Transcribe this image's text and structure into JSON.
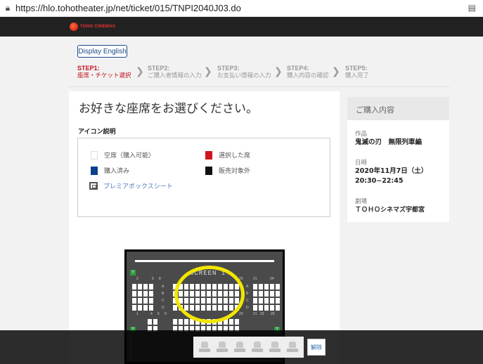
{
  "browser": {
    "url": "https://hlo.tohotheater.jp/net/ticket/015/TNPI2040J03.do"
  },
  "header": {
    "logo_text": "TOHO CINEMAS"
  },
  "main": {
    "english_button": "Display English",
    "steps": [
      {
        "num": "STEP1:",
        "label": "座席・チケット選択"
      },
      {
        "num": "STEP2:",
        "label": "ご購入者情報の入力"
      },
      {
        "num": "STEP3:",
        "label": "お支払い情報の入力"
      },
      {
        "num": "STEP4:",
        "label": "購入内容の確認"
      },
      {
        "num": "STEP5:",
        "label": "購入完了"
      }
    ],
    "heading": "お好きな座席をお選びください。",
    "icon_title": "アイコン説明",
    "legend": {
      "empty": "空席（購入可能）",
      "selected": "選択した席",
      "bought": "購入済み",
      "na": "販売対象外",
      "premier": "プレミアボックスシート"
    },
    "seatmap": {
      "screen_label": "SCREEN 1",
      "rows": [
        "A",
        "B",
        "C",
        "D"
      ],
      "colnums_top": [
        "2",
        "5",
        "8",
        "20",
        "21",
        "24"
      ],
      "colnums_bottom": [
        "1",
        "4",
        "6",
        "9",
        "20",
        "21",
        "22",
        "25"
      ]
    }
  },
  "sidebar": {
    "title": "ご購入内容",
    "movie_label": "作品",
    "movie_value": "鬼滅の刃　無限列車編",
    "date_label": "日時",
    "date_value": "2020年11月7日（土）",
    "time_value": "20:30~22:45",
    "theater_label": "劇場",
    "theater_value": "ＴＯＨＯシネマズ宇都宮"
  },
  "bottom": {
    "cancel_label": "解除",
    "slot_count": 6
  }
}
